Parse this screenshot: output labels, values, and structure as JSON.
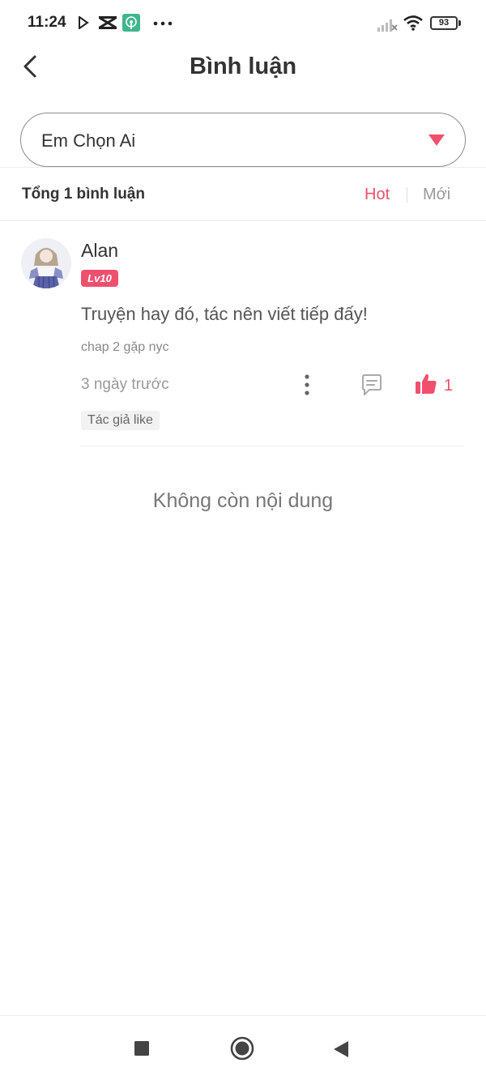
{
  "status_bar": {
    "time": "11:24",
    "battery": "93",
    "icons": [
      "play-store-icon",
      "capcut-icon",
      "podcast-icon",
      "more-dots-icon",
      "signal-icon",
      "wifi-icon",
      "battery-icon"
    ]
  },
  "header": {
    "title": "Bình luận"
  },
  "chapter_select": {
    "value": "Em Chọn Ai"
  },
  "summary": {
    "count_label": "Tổng 1 bình luận",
    "sort_hot": "Hot",
    "sort_new": "Mới",
    "active_sort": "Hot"
  },
  "comments": [
    {
      "username": "Alan",
      "level": "Lv10",
      "text": "Truyện hay đó, tác nên viết tiếp đấy!",
      "chapter": "chap 2 gặp nyc",
      "time": "3 ngày trước",
      "likes": "1",
      "tag": "Tác giả like"
    }
  ],
  "end_message": "Không còn nội dung",
  "colors": {
    "accent": "#f0506e",
    "text": "#333333",
    "muted": "#999999"
  }
}
